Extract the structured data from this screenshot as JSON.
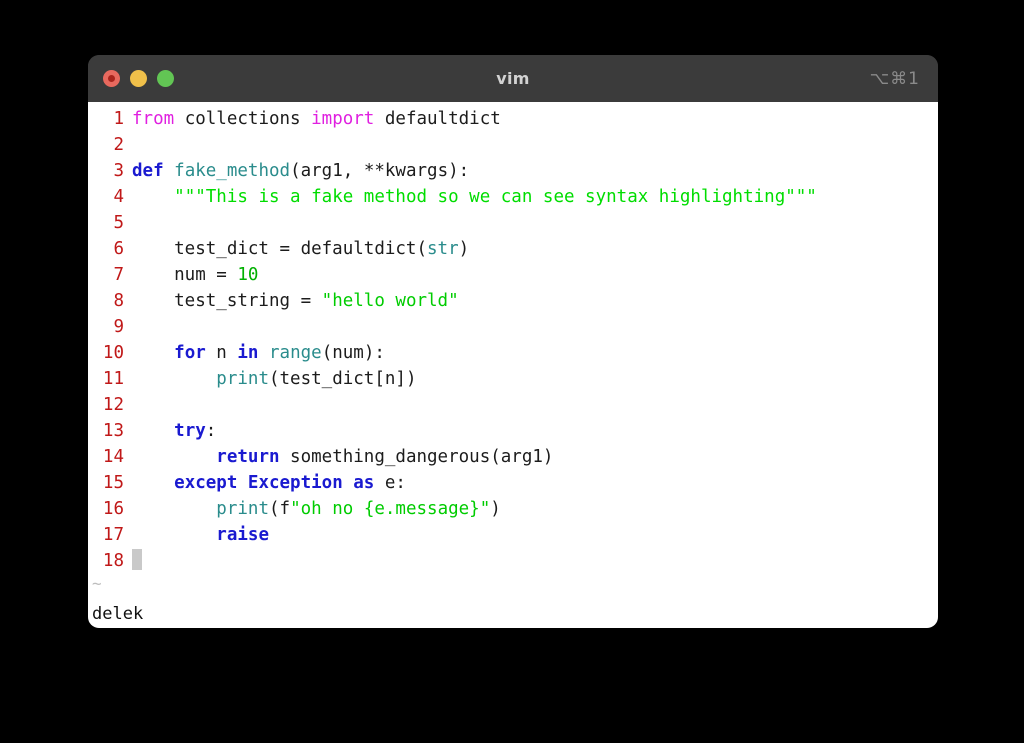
{
  "window": {
    "title": "vim",
    "shortcut": "⌥⌘1",
    "traffic_lights": [
      {
        "name": "close",
        "color": "#e8695e"
      },
      {
        "name": "minimize",
        "color": "#f0c04a"
      },
      {
        "name": "zoom",
        "color": "#62c554"
      }
    ]
  },
  "editor": {
    "colorscheme": "delek",
    "tilde": "~",
    "cursor_line": 18,
    "lines": [
      {
        "n": "1",
        "tokens": [
          {
            "t": "from",
            "c": "pre"
          },
          {
            "t": " collections ",
            "c": "plain"
          },
          {
            "t": "import",
            "c": "pre"
          },
          {
            "t": " defaultdict",
            "c": "plain"
          }
        ]
      },
      {
        "n": "2",
        "tokens": []
      },
      {
        "n": "3",
        "tokens": [
          {
            "t": "def",
            "c": "kw"
          },
          {
            "t": " ",
            "c": "plain"
          },
          {
            "t": "fake_method",
            "c": "fn"
          },
          {
            "t": "(arg1, **kwargs):",
            "c": "plain"
          }
        ]
      },
      {
        "n": "4",
        "tokens": [
          {
            "t": "    ",
            "c": "plain"
          },
          {
            "t": "\"\"\"This is a fake method so we can see syntax highlighting\"\"\"",
            "c": "doc"
          }
        ]
      },
      {
        "n": "5",
        "tokens": []
      },
      {
        "n": "6",
        "tokens": [
          {
            "t": "    test_dict = defaultdict(",
            "c": "plain"
          },
          {
            "t": "str",
            "c": "fn"
          },
          {
            "t": ")",
            "c": "plain"
          }
        ]
      },
      {
        "n": "7",
        "tokens": [
          {
            "t": "    num = ",
            "c": "plain"
          },
          {
            "t": "10",
            "c": "num"
          }
        ]
      },
      {
        "n": "8",
        "tokens": [
          {
            "t": "    test_string = ",
            "c": "plain"
          },
          {
            "t": "\"hello world\"",
            "c": "str"
          }
        ]
      },
      {
        "n": "9",
        "tokens": []
      },
      {
        "n": "10",
        "tokens": [
          {
            "t": "    ",
            "c": "plain"
          },
          {
            "t": "for",
            "c": "kw"
          },
          {
            "t": " n ",
            "c": "plain"
          },
          {
            "t": "in",
            "c": "kw"
          },
          {
            "t": " ",
            "c": "plain"
          },
          {
            "t": "range",
            "c": "fn"
          },
          {
            "t": "(num):",
            "c": "plain"
          }
        ]
      },
      {
        "n": "11",
        "tokens": [
          {
            "t": "        ",
            "c": "plain"
          },
          {
            "t": "print",
            "c": "fn"
          },
          {
            "t": "(test_dict[n])",
            "c": "plain"
          }
        ]
      },
      {
        "n": "12",
        "tokens": []
      },
      {
        "n": "13",
        "tokens": [
          {
            "t": "    ",
            "c": "plain"
          },
          {
            "t": "try",
            "c": "kw"
          },
          {
            "t": ":",
            "c": "plain"
          }
        ]
      },
      {
        "n": "14",
        "tokens": [
          {
            "t": "        ",
            "c": "plain"
          },
          {
            "t": "return",
            "c": "kw"
          },
          {
            "t": " something_dangerous(arg1)",
            "c": "plain"
          }
        ]
      },
      {
        "n": "15",
        "tokens": [
          {
            "t": "    ",
            "c": "plain"
          },
          {
            "t": "except Exception as",
            "c": "kw"
          },
          {
            "t": " e:",
            "c": "plain"
          }
        ]
      },
      {
        "n": "16",
        "tokens": [
          {
            "t": "        ",
            "c": "plain"
          },
          {
            "t": "print",
            "c": "fn"
          },
          {
            "t": "(f",
            "c": "plain"
          },
          {
            "t": "\"oh no {e.message}\"",
            "c": "str"
          },
          {
            "t": ")",
            "c": "plain"
          }
        ]
      },
      {
        "n": "17",
        "tokens": [
          {
            "t": "        ",
            "c": "plain"
          },
          {
            "t": "raise",
            "c": "kw"
          }
        ]
      },
      {
        "n": "18",
        "tokens": [],
        "cursor": true
      }
    ]
  },
  "colors": {
    "window_chrome": "#3b3b3b",
    "editor_bg": "#ffffff",
    "linenumber": "#c01818",
    "keyword": "#1a1ad0",
    "preproc": "#e020e0",
    "function": "#2a8c8c",
    "string": "#00cc00",
    "number": "#00b000",
    "text": "#1c1c1c",
    "cursor": "#c9c9c9",
    "desktop": "#000000"
  }
}
